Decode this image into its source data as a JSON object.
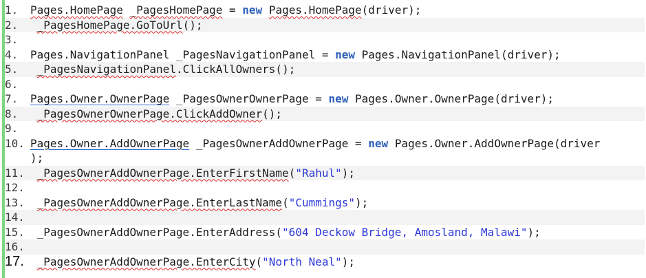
{
  "lines": [
    {
      "num": "1.",
      "t1": "Pages.HomePage",
      "t2": " ",
      "t3": "_PagesHomePage",
      "t4": " = ",
      "t5": "new",
      "t6": " ",
      "t7": "Pages.HomePage",
      "t8": "(driver);"
    },
    {
      "num": "2.",
      "t1": " ",
      "t2": "_PagesHomePage.GoToUrl",
      "t3": "();"
    },
    {
      "num": "3."
    },
    {
      "num": "4.",
      "t1": "Pages.NavigationPanel _PagesNavigationPanel = ",
      "t2": "new",
      "t3": " Pages.NavigationPanel(driver);"
    },
    {
      "num": "5.",
      "t1": " ",
      "t2": "_PagesNavigationPanel",
      "t3": ".ClickAllOwners();"
    },
    {
      "num": "6."
    },
    {
      "num": "7.",
      "t1": "Pages.Owner.OwnerPage",
      "t2": " _PagesOwnerOwnerPage = ",
      "t3": "new",
      "t4": " Pages.Owner.OwnerPage(driver);"
    },
    {
      "num": "8.",
      "t1": " ",
      "t2": "_PagesOwnerOwnerPage.ClickAddOwner",
      "t3": "();"
    },
    {
      "num": "9."
    },
    {
      "num": "10.",
      "t1": "Pages.Owner.AddOwnerPage",
      "t2": " _PagesOwnerAddOwnerPage = ",
      "t3": "new",
      "t4": " Pages.Owner.AddOwnerPage(driver",
      "t5": ");"
    },
    {
      "num": "11.",
      "t1": " ",
      "t2": "_PagesOwnerAddOwnerPage.EnterFirstName",
      "t3": "(",
      "t4": "\"Rahul\"",
      "t5": ");"
    },
    {
      "num": "12."
    },
    {
      "num": "13.",
      "t1": " ",
      "t2": "_PagesOwnerAddOwnerPage.EnterLastName",
      "t3": "(",
      "t4": "\"Cummings\"",
      "t5": ");"
    },
    {
      "num": "14."
    },
    {
      "num": "15.",
      "t1": " _PagesOwnerAddOwnerPage.EnterAddress(",
      "t2": "\"604 Deckow Bridge, Amosland, Malawi\"",
      "t3": ");"
    },
    {
      "num": "16."
    },
    {
      "num": "17.",
      "t1": " ",
      "t2": "_PagesOwnerAddOwnerPage.EnterCity",
      "t3": "(",
      "t4": "\"North Neal\"",
      "t5": ");"
    }
  ],
  "colors": {
    "keyword": "#2f61b8",
    "string": "#2a36d6",
    "gutter": "#7ed67e",
    "squiggle": "#e02a2a"
  }
}
